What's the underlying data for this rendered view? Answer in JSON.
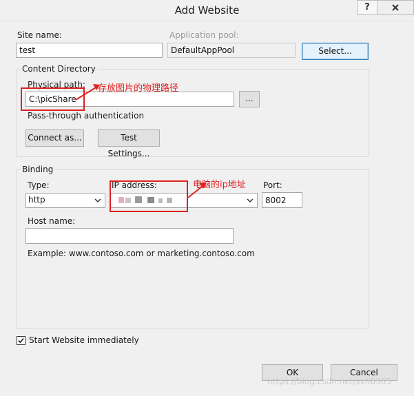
{
  "window": {
    "title": "Add Website",
    "help_label": "?",
    "close_label": "X"
  },
  "site": {
    "name_label": "Site name:",
    "name_value": "test",
    "pool_label": "Application pool:",
    "pool_value": "DefaultAppPool",
    "select_label": "Select..."
  },
  "content": {
    "group_label": "Content Directory",
    "path_label": "Physical path:",
    "path_value": "C:\\picShare",
    "browse_label": "...",
    "pass_through_label": "Pass-through authentication",
    "connect_as_label": "Connect as...",
    "test_settings_label": "Test Settings..."
  },
  "binding": {
    "group_label": "Binding",
    "type_label": "Type:",
    "type_value": "http",
    "ip_label": "IP address:",
    "port_label": "Port:",
    "port_value": "8002",
    "host_label": "Host name:",
    "host_value": "",
    "example": "Example: www.contoso.com or marketing.contoso.com"
  },
  "start": {
    "label": "Start Website immediately",
    "checked": true
  },
  "footer": {
    "ok_label": "OK",
    "cancel_label": "Cancel"
  },
  "annotations": {
    "path_note": "存放图片的物理路径",
    "ip_note": "电脑的ip地址",
    "color": "#e02020"
  },
  "watermark": "https://blog.csdn.net/sxh6365"
}
